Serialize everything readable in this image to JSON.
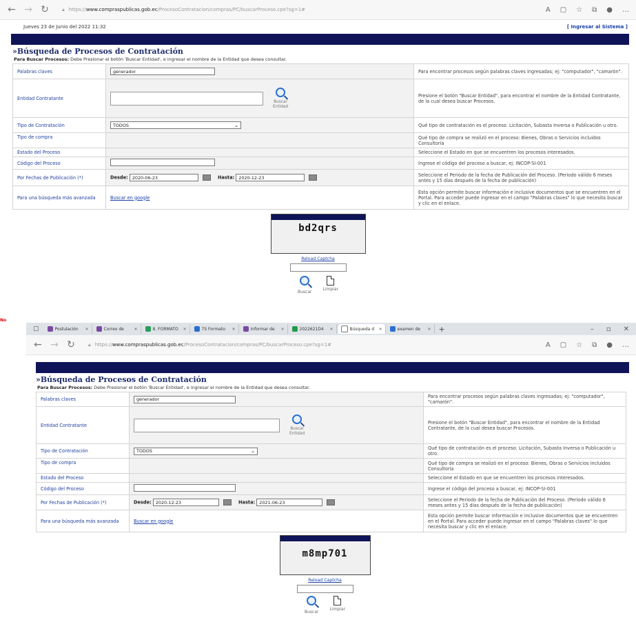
{
  "shot1": {
    "browser": {
      "url_prefix": "https://",
      "url_domain": "www.compraspublicas.gob.ec",
      "url_path": "/ProcesoContratacion/compras/PC/buscarProceso.cpe?sg=1#"
    },
    "date": "Jueves 23 de Junio del 2022 11:32",
    "system_link": "[ Ingresar al Sistema ]",
    "title": "»Búsqueda de Procesos de Contratación",
    "subtitle_bold": "Para Buscar Procesos:",
    "subtitle_rest": " Debe Presionar el botón 'Buscar Entidad', e ingresar el nombre de la Entidad que desea consultar.",
    "rows": {
      "keywords_label": "Palabras claves",
      "keywords_value": "generador",
      "keywords_help": "Para encontrar procesos según palabras claves ingresadas; ej: \"computador\", \"camarón\".",
      "entity_label": "Entidad Contratante",
      "entity_btn": "Buscar Entidad",
      "entity_help": "Presione el botón \"Buscar Entidad\", para encontrar el nombre de la Entidad Contratante, de la cual desea buscar Procesos.",
      "type_label": "Tipo de Contratación",
      "type_value": "TODOS",
      "type_help": "Qué tipo de contratación es el proceso: Licitación, Subasta Inversa o Publicación u otro.",
      "purchase_label": "Tipo de compra",
      "purchase_help": "Qué tipo de compra se realizó en el proceso: Bienes, Obras o Servicios incluidos Consultoría",
      "state_label": "Estado del Proceso",
      "state_help": "Seleccione el Estado en que se encuentren los procesos interesados.",
      "code_label": "Código del Proceso",
      "code_help": "Ingrese el código del proceso a buscar, ej: INCOP-SI-001",
      "dates_label": "Por Fechas de Publicación (*)",
      "from_label": "Desde:",
      "from_value": "2020-06-23",
      "to_label": "Hasta:",
      "to_value": "2020-12-23",
      "dates_help": "Seleccione el Periodo de la fecha de Publicación del Proceso. (Periodo válido 6 meses antes y 15 días después de la fecha de publicación)",
      "advanced_label": "Para una búsqueda más avanzada",
      "advanced_link": "Buscar en google",
      "advanced_help": "Esta opción permite buscar información e inclusive documentos que se encuentren en el Portal. Para acceder puede ingresar en el campo \"Palabras claves\" lo que necesita buscar y clic en el enlace."
    },
    "captcha_text": "bd2qrs",
    "reload": "Reload Captcha",
    "btn_search": "Buscar",
    "btn_clear": "Limpiar",
    "red_fragment": "No"
  },
  "shot2": {
    "tabs": [
      {
        "label": "Postulación",
        "color": "#7a4aa0"
      },
      {
        "label": "Correo de",
        "color": "#7a4aa0"
      },
      {
        "label": "8. FORMATO",
        "color": "#2a9d5a"
      },
      {
        "label": "7S Formato",
        "color": "#2a6fd0"
      },
      {
        "label": "Informar de",
        "color": "#7a4aa0"
      },
      {
        "label": "2022621D4",
        "color": "#1f9a4a"
      },
      {
        "label": "Búsqueda d",
        "color": "#ffffff"
      },
      {
        "label": "examen de",
        "color": "#2a6fd0"
      }
    ],
    "new_tab": "+",
    "browser": {
      "url_prefix": "https://",
      "url_domain": "www.compraspublicas.gob.ec",
      "url_path": "/ProcesoContratacion/compras/PC/buscarProceso.cpe?sg=1#"
    },
    "title": "»Búsqueda de Procesos de Contratación",
    "subtitle_bold": "Para Buscar Procesos:",
    "subtitle_rest": " Debe Presionar el botón 'Buscar Entidad', e ingresar el nombre de la Entidad que desea consultar.",
    "rows": {
      "keywords_label": "Palabras claves",
      "keywords_value": "generador",
      "keywords_help": "Para encontrar procesos según palabras claves ingresadas; ej: \"computador\", \"camarón\".",
      "entity_label": "Entidad Contratante",
      "entity_btn": "Buscar Entidad",
      "entity_help": "Presione el botón \"Buscar Entidad\", para encontrar el nombre de la Entidad Contratante, de la cual desea buscar Procesos.",
      "type_label": "Tipo de Contratación",
      "type_value": "TODOS",
      "type_help": "Qué tipo de contratación es el proceso: Licitación, Subasta Inversa o Publicación u otro.",
      "purchase_label": "Tipo de compra",
      "purchase_help": "Qué tipo de compra se realizó en el proceso: Bienes, Obras o Servicios incluidos Consultoría",
      "state_label": "Estado del Proceso",
      "state_help": "Seleccione el Estado en que se encuentren los procesos interesados.",
      "code_label": "Código del Proceso",
      "code_help": "Ingrese el código del proceso a buscar, ej: INCOP-SI-001",
      "dates_label": "Por Fechas de Publicación (*)",
      "from_label": "Desde:",
      "from_value": "2020-12-23",
      "to_label": "Hasta:",
      "to_value": "2021-06-23",
      "dates_help": "Seleccione el Periodo de la fecha de Publicación del Proceso. (Periodo válido 6 meses antes y 15 días después de la fecha de publicación)",
      "advanced_label": "Para una búsqueda más avanzada",
      "advanced_link": "Buscar en google",
      "advanced_help": "Esta opción permite buscar información e inclusive documentos que se encuentren en el Portal. Para acceder puede ingresar en el campo \"Palabras claves\" lo que necesita buscar y clic en el enlace."
    },
    "captcha_text": "m8mp701",
    "reload": "Reload Captcha",
    "btn_search": "Buscar",
    "btn_clear": "Limpiar"
  },
  "colors": {
    "navy": "#0e1457",
    "label_blue": "#1f3f9e",
    "link_blue": "#1a3fa6"
  }
}
